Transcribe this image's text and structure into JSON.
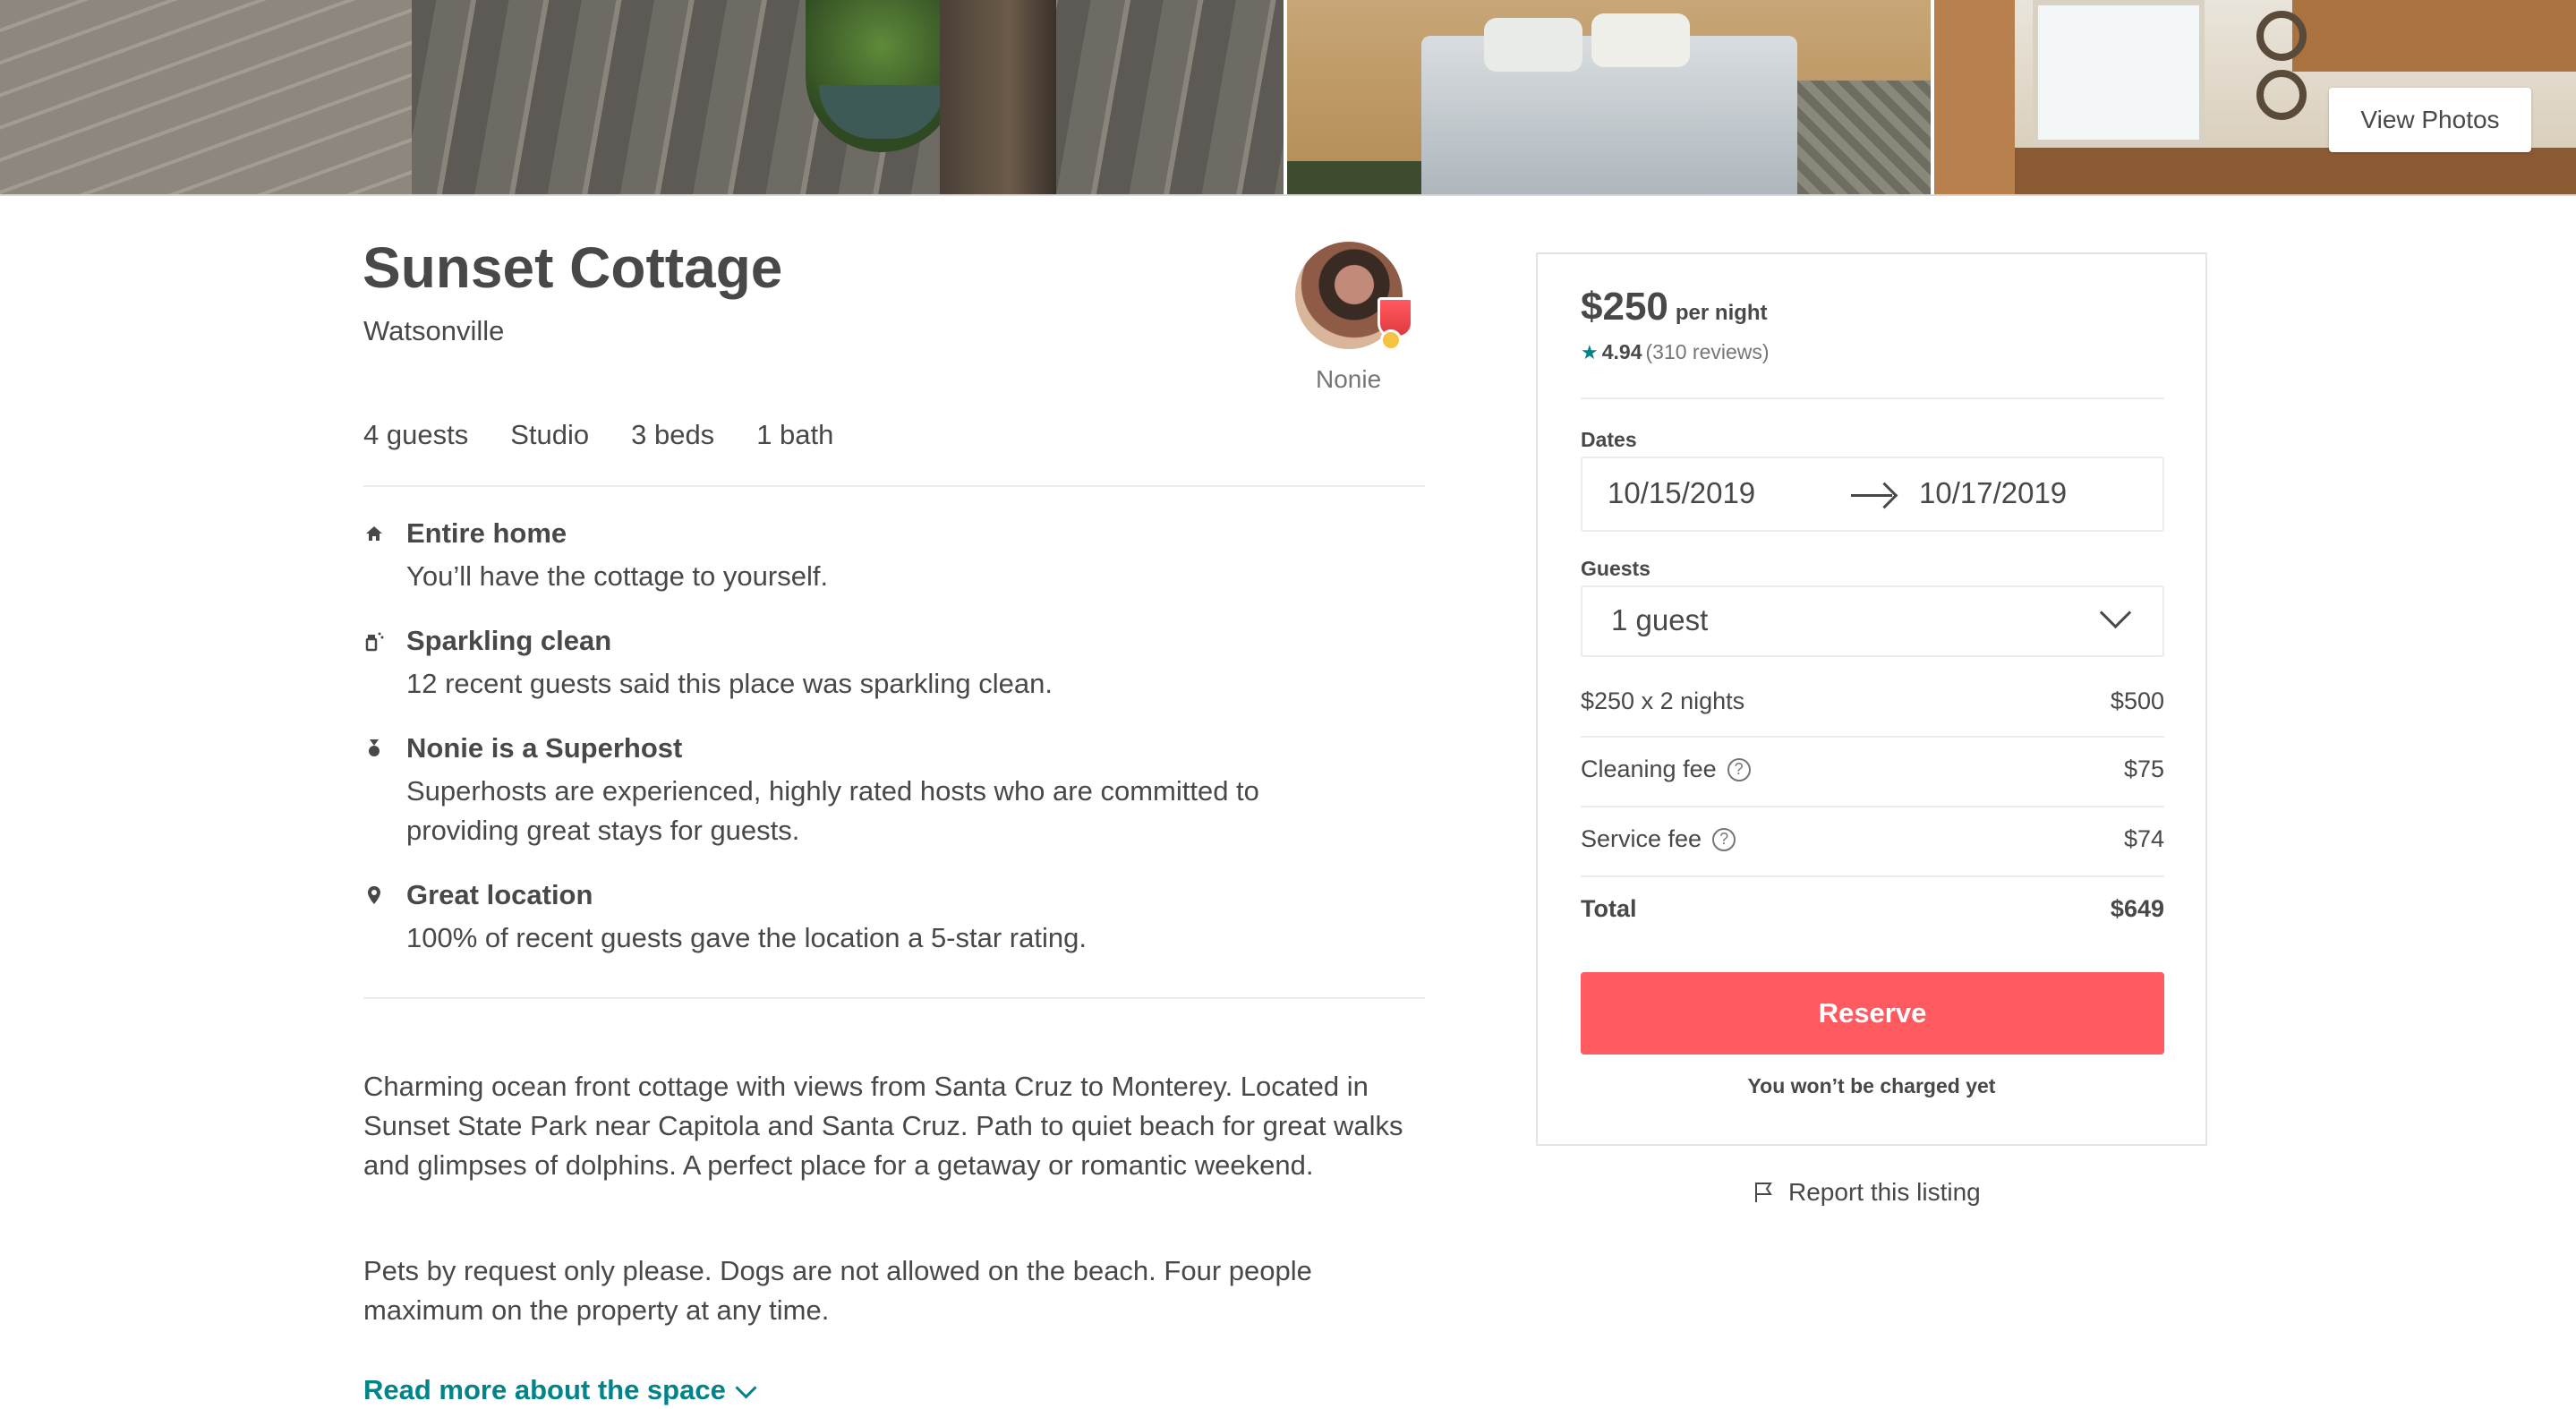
{
  "photos": {
    "view_photos_label": "View Photos"
  },
  "listing": {
    "title": "Sunset Cottage",
    "location": "Watsonville",
    "stats": [
      "4 guests",
      "Studio",
      "3 beds",
      "1 bath"
    ]
  },
  "host": {
    "name": "Nonie"
  },
  "highlights": [
    {
      "icon": "home-icon",
      "title": "Entire home",
      "description": "You’ll have the cottage to yourself."
    },
    {
      "icon": "spray-bottle-icon",
      "title": "Sparkling clean",
      "description": "12 recent guests said this place was sparkling clean."
    },
    {
      "icon": "medal-icon",
      "title": "Nonie is a Superhost",
      "description": "Superhosts are experienced, highly rated hosts who are committed to providing great stays for guests."
    },
    {
      "icon": "map-pin-icon",
      "title": "Great location",
      "description": "100% of recent guests gave the location a 5-star rating."
    }
  ],
  "description": {
    "paragraphs": [
      "Charming ocean front cottage with views from Santa Cruz to Monterey. Located in Sunset State Park near Capitola and Santa Cruz. Path to quiet beach for great walks and glimpses of dolphins. A perfect place for a getaway or romantic weekend.",
      "Pets by request only please. Dogs are not allowed on the beach. Four people maximum on the property at any time."
    ],
    "read_more_label": "Read more about the space"
  },
  "booking": {
    "price": "$250",
    "per_night_label": "per night",
    "rating_score": "4.94",
    "reviews_text": "(310 reviews)",
    "dates_label": "Dates",
    "check_in": "10/15/2019",
    "check_out": "10/17/2019",
    "guests_label": "Guests",
    "guests_value": "1 guest",
    "fees": [
      {
        "label": "$250 x 2 nights",
        "amount": "$500",
        "help": false
      },
      {
        "label": "Cleaning fee",
        "amount": "$75",
        "help": true
      },
      {
        "label": "Service fee",
        "amount": "$74",
        "help": true
      }
    ],
    "total_label": "Total",
    "total_amount": "$649",
    "reserve_label": "Reserve",
    "no_charge_note": "You won’t be charged yet"
  },
  "report_label": "Report this listing",
  "colors": {
    "brand": "#FF5A5F",
    "teal": "#008489",
    "text": "#484848",
    "muted": "#767676",
    "border": "#EBEBEB"
  }
}
